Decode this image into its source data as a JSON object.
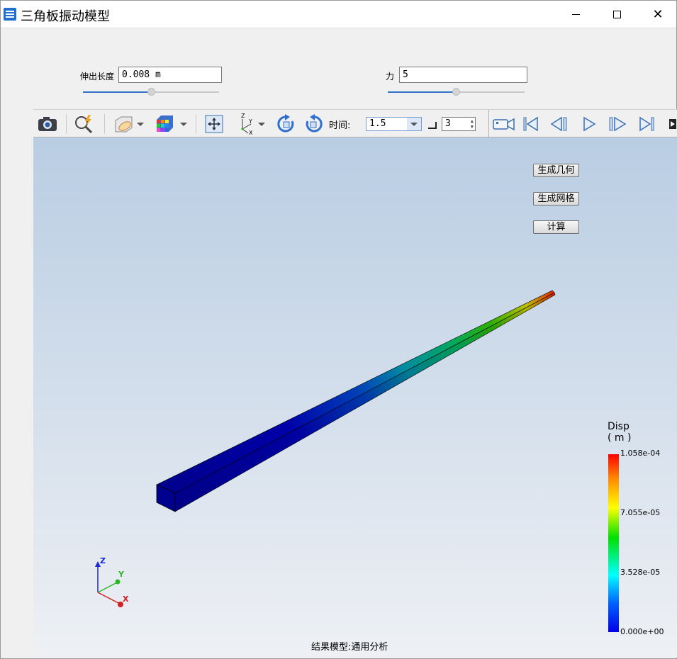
{
  "window": {
    "title": "三角板振动模型"
  },
  "params": {
    "length_label": "伸出长度",
    "length_value": "0.008 m",
    "length_slider": 0.5,
    "force_label": "力",
    "force_value": "5",
    "force_slider": 0.5
  },
  "toolbar": {
    "time_label": "时间:",
    "time_value": "1.5",
    "step_value": "3"
  },
  "viewport": {
    "btn_geometry": "生成几何",
    "btn_mesh": "生成网格",
    "btn_compute": "计算",
    "axes": {
      "z": "Z",
      "y": "Y",
      "x": "X"
    },
    "status": "结果模型:通用分析"
  },
  "legend": {
    "title_line1": "Disp",
    "title_line2": "( m )",
    "max": "1.058e-04",
    "mid_high": "7.055e-05",
    "mid_low": "3.528e-05",
    "min": "0.000e+00"
  },
  "colors": {
    "accent": "#3272c8",
    "beam_base": "#00008b",
    "tip": "#ff0000"
  }
}
